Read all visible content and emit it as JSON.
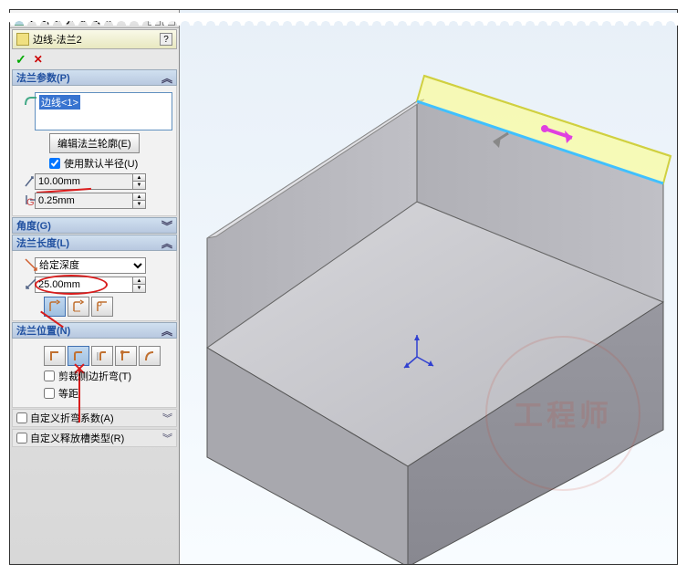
{
  "pm": {
    "title": "PropertyManager"
  },
  "feature": {
    "name": "边线-法兰2",
    "help": "?"
  },
  "okcancel": {
    "ok": "✓",
    "cancel": "✕"
  },
  "params": {
    "title": "法兰参数(P)",
    "edge_item": "边线<1>",
    "edit_profile_btn": "编辑法兰轮廓(E)",
    "use_default_radius": "使用默认半径(U)",
    "radius": "10.00mm",
    "gap": "0.25mm"
  },
  "angle": {
    "title": "角度(G)"
  },
  "length": {
    "title": "法兰长度(L)",
    "end_condition": "给定深度",
    "value": "25.00mm"
  },
  "position": {
    "title": "法兰位置(N)",
    "trim_side_bends": "剪裁侧边折弯(T)",
    "offset": "等距"
  },
  "custom_bend": {
    "label": "自定义折弯系数(A)"
  },
  "custom_relief": {
    "label": "自定义释放槽类型(R)"
  }
}
